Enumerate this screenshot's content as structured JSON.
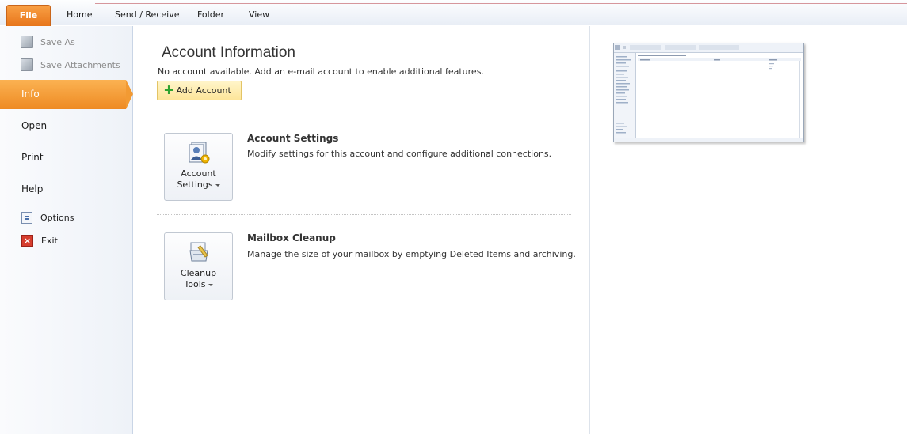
{
  "ribbon": {
    "tabs": [
      "File",
      "Home",
      "Send / Receive",
      "Folder",
      "View"
    ]
  },
  "nav": {
    "save_as": "Save As",
    "save_attachments": "Save Attachments",
    "info": "Info",
    "open": "Open",
    "print": "Print",
    "help": "Help",
    "options": "Options",
    "exit": "Exit"
  },
  "main": {
    "title": "Account Information",
    "subtitle": "No account available. Add an e-mail account to enable additional features.",
    "add_account": "Add Account",
    "sections": [
      {
        "button_line1": "Account",
        "button_line2": "Settings",
        "heading": "Account Settings",
        "description": "Modify settings for this account and configure additional connections."
      },
      {
        "button_line1": "Cleanup",
        "button_line2": "Tools",
        "heading": "Mailbox Cleanup",
        "description": "Manage the size of your mailbox by emptying Deleted Items and archiving."
      }
    ]
  },
  "colors": {
    "file_tab": "#e7751a",
    "info_selected": "#f29a33",
    "add_account_bg": "#fde59a"
  }
}
